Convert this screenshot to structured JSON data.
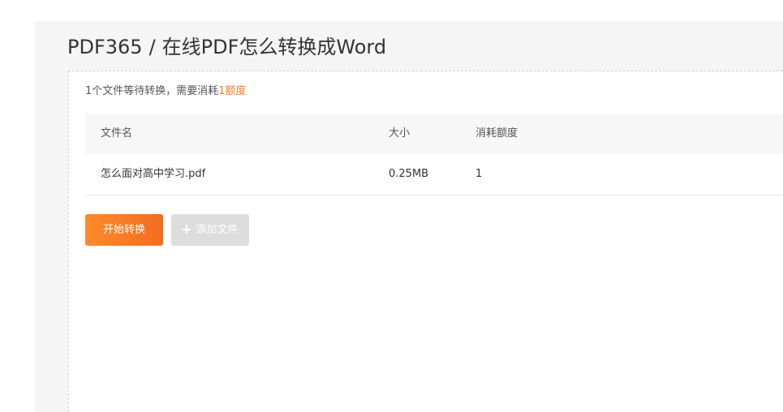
{
  "header": {
    "brand": "PDF365",
    "separator": "/",
    "title": "在线PDF怎么转换成Word"
  },
  "info": {
    "prefix": "1个文件等待转换，需要消耗",
    "credit_amount": "1额度"
  },
  "table": {
    "columns": {
      "name": "文件名",
      "size": "大小",
      "credit": "消耗额度"
    },
    "rows": [
      {
        "name": "怎么面对高中学习.pdf",
        "size": "0.25MB",
        "credit": "1"
      }
    ]
  },
  "actions": {
    "start_label": "开始转换",
    "add_label": "添加文件",
    "add_icon": "plus-icon"
  },
  "colors": {
    "accent": "#f07c28",
    "button_start": "#ff8a2b",
    "button_disabled": "#dddddd",
    "panel_bg": "#f5f5f5"
  }
}
